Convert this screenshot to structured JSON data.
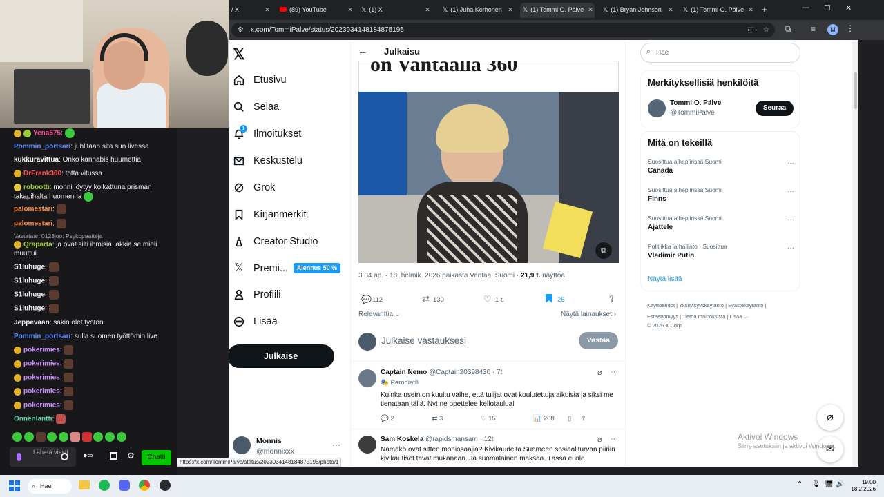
{
  "browser": {
    "tabs": [
      {
        "title": "/ X"
      },
      {
        "title": "(89) YouTube"
      },
      {
        "title": "(1) X"
      },
      {
        "title": "(1) Juha Korhonen"
      },
      {
        "title": "(1) Tommi O. Pälve"
      },
      {
        "title": "(1) Bryan Johnson"
      },
      {
        "title": "(1) Tommi O. Pälve"
      }
    ],
    "new_tab": "+",
    "url": "x.com/TommiPalve/status/2023934148184875195",
    "profile_initial": "M",
    "status_url": "https://x.com/TommiPalve/status/2023934148184875195/photo/1"
  },
  "x_nav": {
    "items": [
      {
        "label": "Etusivu",
        "icon": "home-icon"
      },
      {
        "label": "Selaa",
        "icon": "search-icon"
      },
      {
        "label": "Ilmoitukset",
        "icon": "bell-icon",
        "badge": "1"
      },
      {
        "label": "Keskustelu",
        "icon": "mail-icon"
      },
      {
        "label": "Grok",
        "icon": "grok-icon"
      },
      {
        "label": "Kirjanmerkit",
        "icon": "bookmark-icon"
      },
      {
        "label": "Creator Studio",
        "icon": "creator-icon"
      },
      {
        "label": "Premi...",
        "icon": "x-logo-icon",
        "promo": "Alennus 50 %"
      },
      {
        "label": "Profiili",
        "icon": "person-icon"
      },
      {
        "label": "Lisää",
        "icon": "more-icon"
      }
    ],
    "post_button": "Julkaise",
    "account": {
      "name": "Monnis",
      "handle": "@monnixxx"
    }
  },
  "post": {
    "header_title": "Julkaisu",
    "headline_fragment": "on Vantaalla 360",
    "meta_time": "3.34 ap. · 18. helmik. 2026 paikasta Vantaa, Suomi ·",
    "views_count": "21,9 t.",
    "views_label": "näyttöä",
    "stats": {
      "replies": "112",
      "reposts": "130",
      "likes": "1 t.",
      "bookmarks": "25"
    },
    "sort_label": "Relevanttia",
    "quotes_link": "Näytä lainaukset",
    "reply_placeholder": "Julkaise vastauksesi",
    "reply_button": "Vastaa"
  },
  "replies": [
    {
      "name": "Captain Nemo",
      "handle": "@Captain20398430",
      "time": "· 7t",
      "tag": "Parodiatili",
      "text": "Kuinka usein on kuultu valhe, että tulijat ovat koulutettuja aikuisia ja siksi me tienataan tällä. Nyt ne opettelee kellotaulua!",
      "replies": "2",
      "reposts": "3",
      "likes": "15",
      "views": "208"
    },
    {
      "name": "Sam Koskela",
      "handle": "@rapidsmansam",
      "time": "· 12t",
      "text": "Nämäkö ovat sitten moniosaajia? Kivikaudelta Suomeen sosiaaliturvan piiriin kivikautiset tavat mukanaan. Ja suomalainen maksaa. Tässä ei ole"
    }
  ],
  "right_rail": {
    "search_placeholder": "Hae",
    "relevant_title": "Merkityksellisiä henkilöitä",
    "person": {
      "name": "Tommi O. Pälve",
      "handle": "@TommiPalve",
      "follow": "Seuraa"
    },
    "trends_title": "Mitä on tekeillä",
    "trends": [
      {
        "context": "Suosittua aihepiirissä Suomi",
        "name": "Canada"
      },
      {
        "context": "Suosittua aihepiirissä Suomi",
        "name": "Finns"
      },
      {
        "context": "Suosittua aihepiirissä Suomi",
        "name": "Ajattele"
      },
      {
        "context": "Politiikka ja hallinto · Suosittua",
        "name": "Vladimir Putin"
      }
    ],
    "show_more": "Näytä lisää",
    "footer_line1": "Käyttöehdot  |  Yksityisyyskäytäntö  |  Evästekäytäntö  |",
    "footer_line2": "Esteettömyys  |  Tietoa mainoksista  |  Lisää ···",
    "footer_line3": "© 2026 X Corp."
  },
  "chat": {
    "messages": [
      {
        "user": "Yena575",
        "color": "#ff4f8b",
        "text": ""
      },
      {
        "user": "Pommin_portsari",
        "color": "#5b8cff",
        "text": "juhlitaan sitä sun livessä"
      },
      {
        "user": "kukkuravittua",
        "color": "#ffffff",
        "text": "Onko kannabis huumettia"
      },
      {
        "user": "DrFrank360",
        "color": "#ff4f4f",
        "text": "totta vitussa"
      },
      {
        "user": "roboottı",
        "color": "#9acd32",
        "text": "monni löytyy kolkattuna prisman takapihalta huomenna"
      },
      {
        "user": "palomestari",
        "color": "#ff8c3c",
        "text": ""
      },
      {
        "user": "palomestari",
        "color": "#ff8c3c",
        "text": ""
      },
      {
        "user": "Qraparta",
        "color": "#9acd32",
        "text": "ja ovat silti ihmisiä. äkkiä se mieli muuttui"
      },
      {
        "user": "S1luhuge",
        "color": "#ffffff",
        "text": ""
      },
      {
        "user": "S1luhuge",
        "color": "#ffffff",
        "text": ""
      },
      {
        "user": "S1luhuge",
        "color": "#ffffff",
        "text": ""
      },
      {
        "user": "S1luhuge",
        "color": "#ffffff",
        "text": ""
      },
      {
        "user": "Jeppevaan",
        "color": "#ffffff",
        "text": "säkin olet työtön"
      },
      {
        "user": "Pommin_portsari",
        "color": "#5b8cff",
        "text": "sulla suomen työttömin live"
      },
      {
        "user": "pokerimies",
        "color": "#c58cff",
        "text": ""
      },
      {
        "user": "pokerimies",
        "color": "#c58cff",
        "text": ""
      },
      {
        "user": "pokerimies",
        "color": "#c58cff",
        "text": ""
      },
      {
        "user": "pokerimies",
        "color": "#c58cff",
        "text": ""
      },
      {
        "user": "pokerimies",
        "color": "#c58cff",
        "text": ""
      },
      {
        "user": "Onnenlantti",
        "color": "#5ad8a6",
        "text": ""
      }
    ],
    "reply_context": "Vastataan 0123joo: Psykopaatteja",
    "input_placeholder": "Lähetä viesti",
    "send_button": "Chatti"
  },
  "windows": {
    "watermark_title": "Aktivoi Windows",
    "watermark_sub": "Siirry asetuksiin ja aktivoi Windows.",
    "search": "Hae",
    "time": "19.00",
    "date": "18.2.2026"
  },
  "colors": {
    "x_blue": "#1d9bf0",
    "twitch_green": "#00c500",
    "chrome_dark": "#202124"
  }
}
